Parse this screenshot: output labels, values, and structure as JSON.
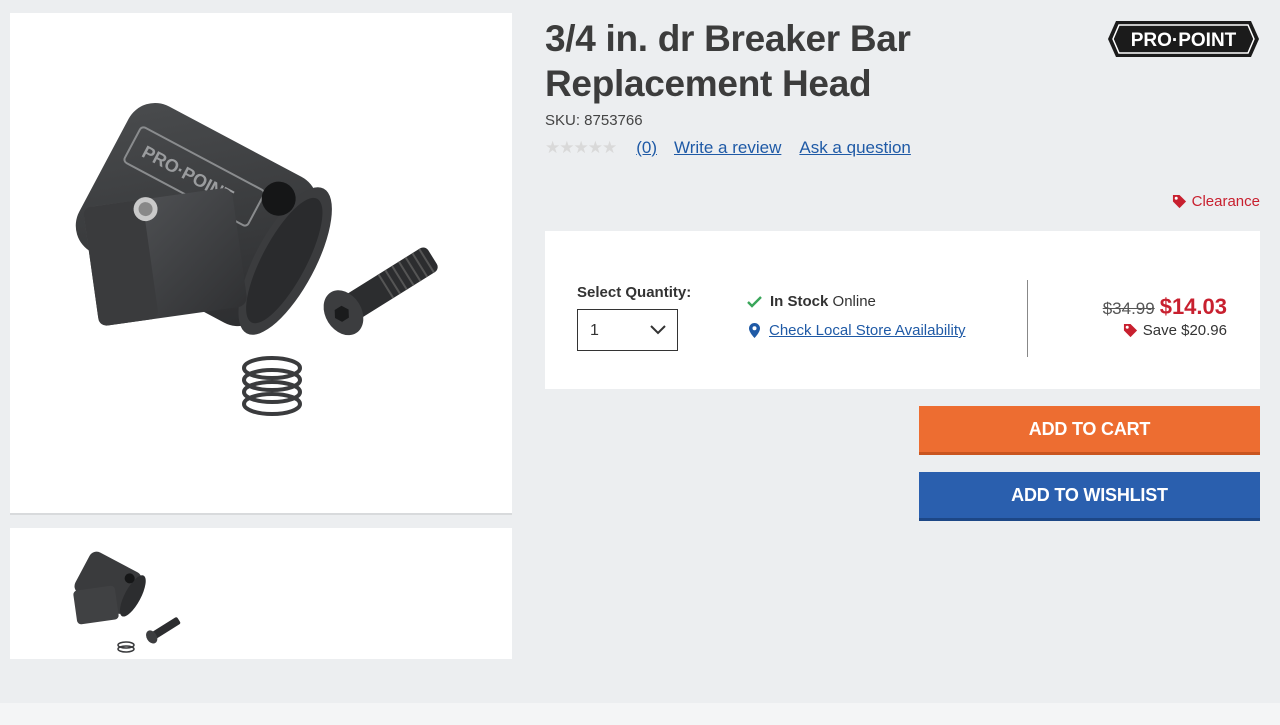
{
  "product": {
    "title": "3/4 in. dr Breaker Bar Replacement Head",
    "sku": "SKU: 8753766",
    "brand": "PRO·POINT"
  },
  "reviews": {
    "count_label": "(0)",
    "write_label": "Write a review",
    "ask_label": "Ask a question",
    "rating": 0,
    "max_rating": 5
  },
  "badge": {
    "label": "Clearance",
    "color": "#c8202f"
  },
  "purchase": {
    "qty_label": "Select Quantity:",
    "qty_value": "1",
    "stock_status": "In Stock",
    "stock_channel": "Online",
    "store_link": "Check Local Store Availability",
    "old_price": "$34.99",
    "new_price": "$14.03",
    "save_label": "Save $20.96"
  },
  "buttons": {
    "cart": "ADD TO CART",
    "wishlist": "ADD TO WISHLIST"
  },
  "colors": {
    "accent_orange": "#ed6d31",
    "accent_blue": "#2a5fae",
    "sale_red": "#c8202f",
    "link_blue": "#1f5aa6",
    "stock_green": "#3aa65a"
  },
  "icons": {
    "check": "check-icon",
    "pin": "map-pin-icon",
    "tag": "price-tag-icon",
    "chevron": "chevron-down-icon"
  }
}
